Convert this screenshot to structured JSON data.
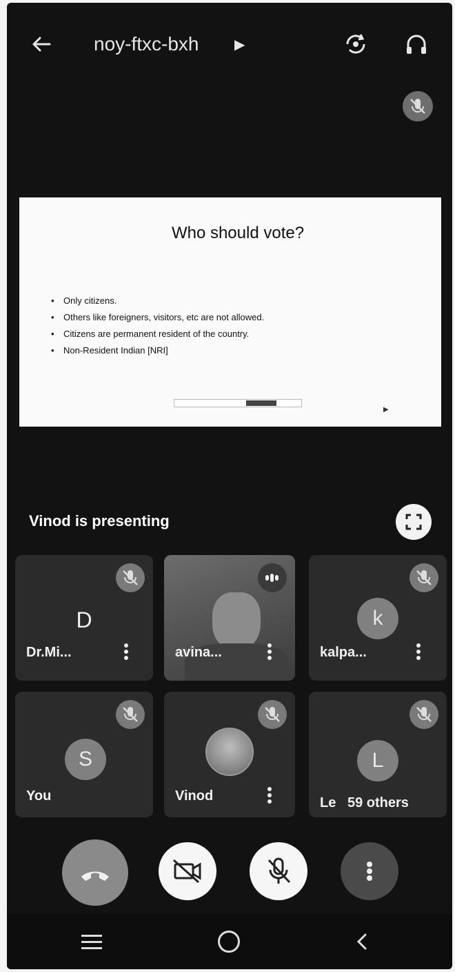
{
  "meeting": {
    "code": "noy-ftxc-bxh"
  },
  "presentation": {
    "presenter_label": "Vinod is presenting",
    "slide_title": "Who should vote?",
    "bullets": [
      "Only citizens.",
      "Others like foreigners, visitors, etc are not allowed.",
      "Citizens are permanent resident of the country.",
      "Non-Resident Indian [NRI]"
    ]
  },
  "participants": [
    {
      "name": "Dr.Mi...",
      "initial": "D",
      "muted": true
    },
    {
      "name": "avina...",
      "initial": "",
      "muted": false,
      "speaking": true
    },
    {
      "name": "kalpa...",
      "initial": "k",
      "muted": true
    },
    {
      "name": "You",
      "initial": "S",
      "muted": true
    },
    {
      "name": "Vinod",
      "initial": "",
      "muted": true
    },
    {
      "name": "Le",
      "initial": "L",
      "muted": true
    }
  ],
  "others_label": "59 others",
  "icons": {
    "back": "arrow-left-icon",
    "rotate": "switch-camera-icon",
    "audio": "headphones-icon",
    "fullscreen": "fullscreen-icon",
    "end": "hang-up-icon",
    "camera": "camera-off-icon",
    "mic": "mic-off-icon",
    "more": "more-vert-icon"
  },
  "colors": {
    "background": "#121212",
    "tile": "#2b2b2b",
    "control_light": "#f6f6f6"
  }
}
